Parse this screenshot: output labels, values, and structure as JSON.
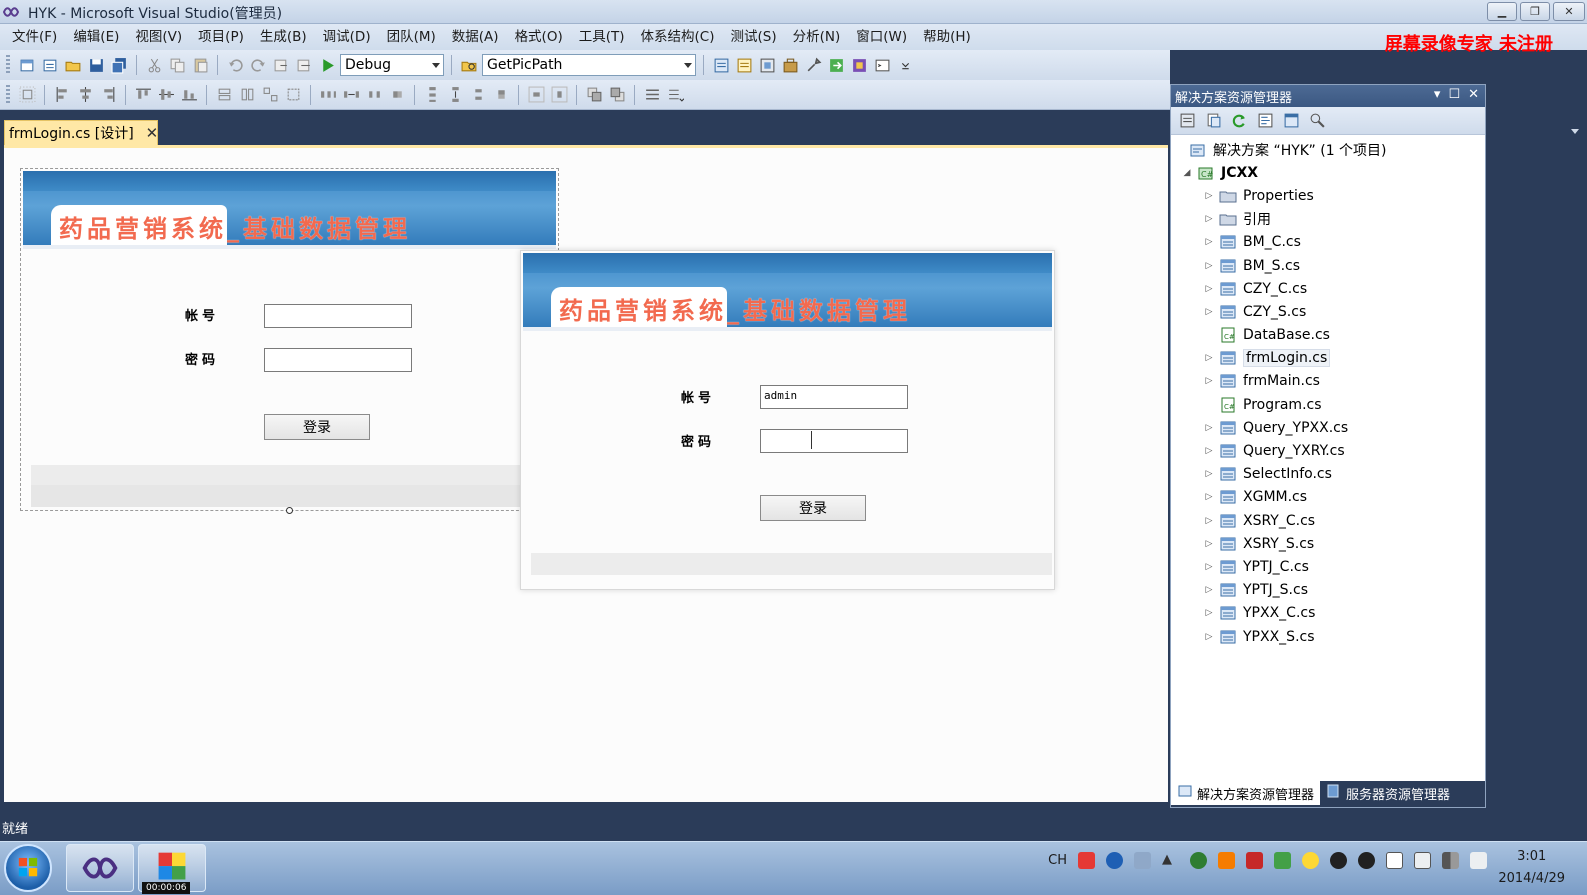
{
  "window": {
    "title": "HYK - Microsoft Visual Studio(管理员)",
    "watermark": "屏幕录像专家  未注册"
  },
  "menu": [
    "文件(F)",
    "编辑(E)",
    "视图(V)",
    "项目(P)",
    "生成(B)",
    "调试(D)",
    "团队(M)",
    "数据(A)",
    "格式(O)",
    "工具(T)",
    "体系结构(C)",
    "测试(S)",
    "分析(N)",
    "窗口(W)",
    "帮助(H)"
  ],
  "toolbar": {
    "config_value": "Debug",
    "find_value": "GetPicPath"
  },
  "doc_tab": {
    "label": "frmLogin.cs [设计]",
    "close": "✕"
  },
  "forms": [
    {
      "banner_title": "药品营销系统_基础数据管理",
      "account_label": "帐号",
      "password_label": "密码",
      "account_value": "",
      "password_value": "",
      "login_button": "登录"
    },
    {
      "banner_title": "药品营销系统_基础数据管理",
      "account_label": "帐号",
      "password_label": "密码",
      "account_value": "admin",
      "password_value": "",
      "login_button": "登录"
    }
  ],
  "solution_explorer": {
    "title": "解决方案资源管理器",
    "solution": "解决方案 “HYK” (1 个项目)",
    "project": "JCXX",
    "items": [
      {
        "label": "Properties",
        "icon": "properties-folder-icon",
        "expandable": true
      },
      {
        "label": "引用",
        "icon": "references-folder-icon",
        "expandable": true
      },
      {
        "label": "BM_C.cs",
        "icon": "form-file-icon",
        "expandable": true
      },
      {
        "label": "BM_S.cs",
        "icon": "form-file-icon",
        "expandable": true
      },
      {
        "label": "CZY_C.cs",
        "icon": "form-file-icon",
        "expandable": true
      },
      {
        "label": "CZY_S.cs",
        "icon": "form-file-icon",
        "expandable": true
      },
      {
        "label": "DataBase.cs",
        "icon": "cs-code-file-icon",
        "expandable": false
      },
      {
        "label": "frmLogin.cs",
        "icon": "form-file-icon",
        "expandable": true,
        "selected": true
      },
      {
        "label": "frmMain.cs",
        "icon": "form-file-icon",
        "expandable": true
      },
      {
        "label": "Program.cs",
        "icon": "cs-code-file-icon",
        "expandable": false
      },
      {
        "label": "Query_YPXX.cs",
        "icon": "form-file-icon",
        "expandable": true
      },
      {
        "label": "Query_YXRY.cs",
        "icon": "form-file-icon",
        "expandable": true
      },
      {
        "label": "SelectInfo.cs",
        "icon": "form-file-icon",
        "expandable": true
      },
      {
        "label": "XGMM.cs",
        "icon": "form-file-icon",
        "expandable": true
      },
      {
        "label": "XSRY_C.cs",
        "icon": "form-file-icon",
        "expandable": true
      },
      {
        "label": "XSRY_S.cs",
        "icon": "form-file-icon",
        "expandable": true
      },
      {
        "label": "YPTJ_C.cs",
        "icon": "form-file-icon",
        "expandable": true
      },
      {
        "label": "YPTJ_S.cs",
        "icon": "form-file-icon",
        "expandable": true
      },
      {
        "label": "YPXX_C.cs",
        "icon": "form-file-icon",
        "expandable": true
      },
      {
        "label": "YPXX_S.cs",
        "icon": "form-file-icon",
        "expandable": true
      }
    ],
    "tab_solution": "解决方案资源管理器",
    "tab_server": "服务器资源管理器"
  },
  "status": {
    "text": "就绪"
  },
  "taskbar": {
    "ime": "CH",
    "time": "3:01",
    "date": "2014/4/29",
    "recording_time": "00:00:06"
  },
  "colors": {
    "chrome_dark": "#2b3c59",
    "active_tab": "#ffe8a6",
    "banner_blue": "#3c87c6",
    "banner_title": "#f26a4f",
    "watermark": "#ff0000"
  }
}
